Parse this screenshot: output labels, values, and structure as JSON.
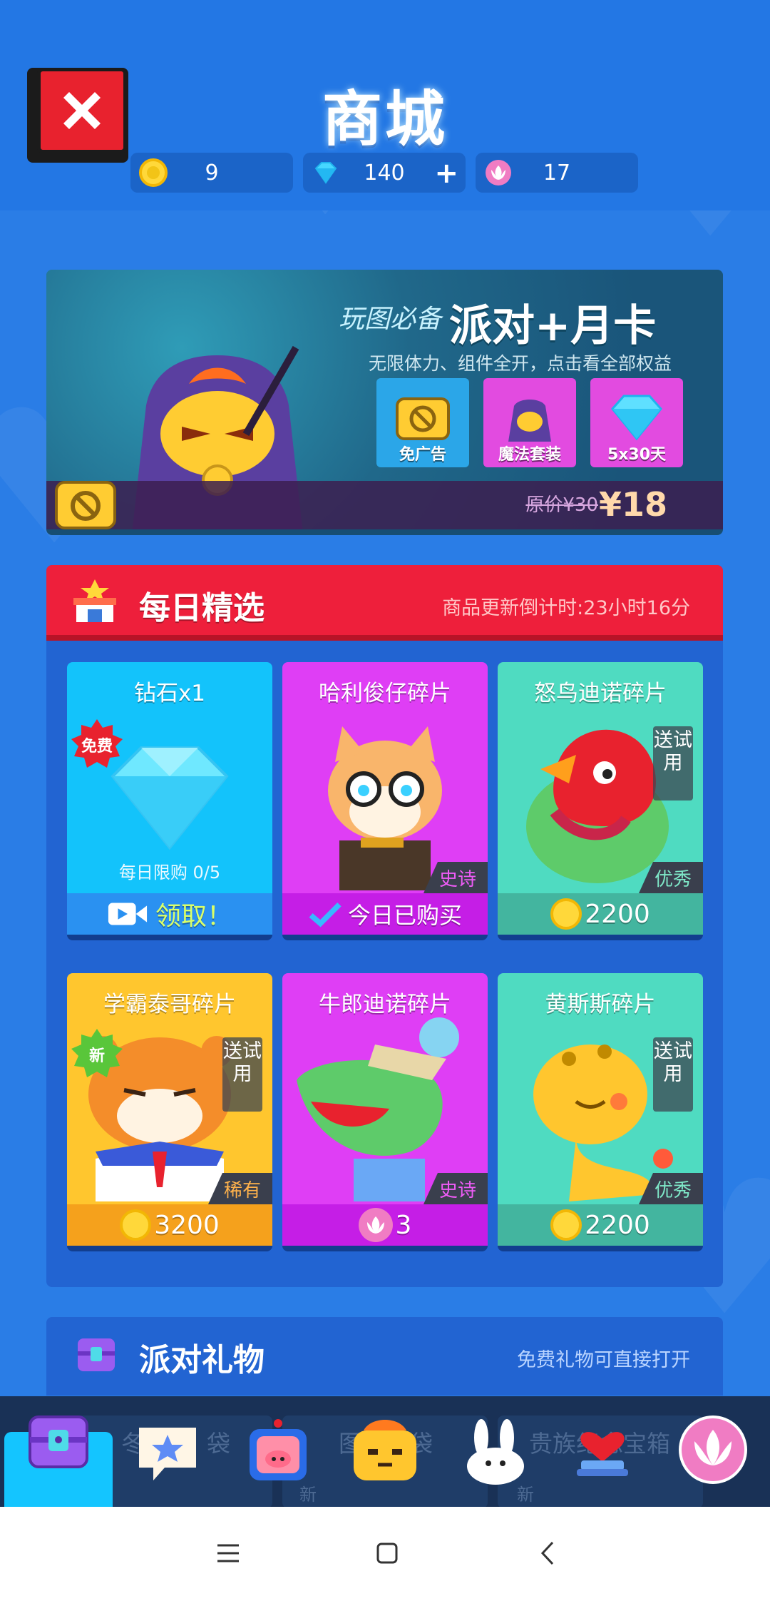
{
  "header": {
    "title": "商城",
    "currencies": [
      {
        "name": "coin-icon",
        "value": "9"
      },
      {
        "name": "diamond-icon",
        "value": "140",
        "plus": "+"
      },
      {
        "name": "lotus-icon",
        "value": "17"
      }
    ]
  },
  "banner": {
    "slogan": "玩图必备",
    "title": "派对+月卡",
    "subtitle": "无限体力、组件全开，点击看全部权益",
    "perks": [
      "免广告",
      "魔法套装",
      "5x30天"
    ],
    "original_price": "原价¥30",
    "price": "¥18"
  },
  "daily": {
    "title": "每日精选",
    "timer": "商品更新倒计时:23小时16分",
    "cards": [
      {
        "title": "钻石x1",
        "badge": "免费",
        "limit": "每日限购 0/5",
        "footer": "领取！"
      },
      {
        "title": "哈利俊仔碎片",
        "rarity": "史诗",
        "footer": "今日已购买"
      },
      {
        "title": "怒鸟迪诺碎片",
        "trial": "送试用",
        "rarity": "优秀",
        "footer": "2200"
      },
      {
        "title": "学霸泰哥碎片",
        "badge": "新",
        "trial": "送试用",
        "rarity": "稀有",
        "footer": "3200"
      },
      {
        "title": "牛郎迪诺碎片",
        "rarity": "史诗",
        "footer": "3"
      },
      {
        "title": "黄斯斯碎片",
        "trial": "送试用",
        "rarity": "优秀",
        "footer": "2200"
      }
    ]
  },
  "gift": {
    "title": "派对礼物",
    "note": "免费礼物可直接打开",
    "peek": [
      "冬",
      "袋",
      "图",
      "袋",
      "贵族纪念宝箱"
    ],
    "new_tags": [
      "新",
      "新"
    ]
  },
  "colors": {
    "bg": "#2a7de6",
    "red": "#ee1f3b",
    "cyan": "#14c5ff",
    "magenta": "#df3ef5",
    "teal": "#4fdbc1",
    "orange": "#ffc62e"
  }
}
